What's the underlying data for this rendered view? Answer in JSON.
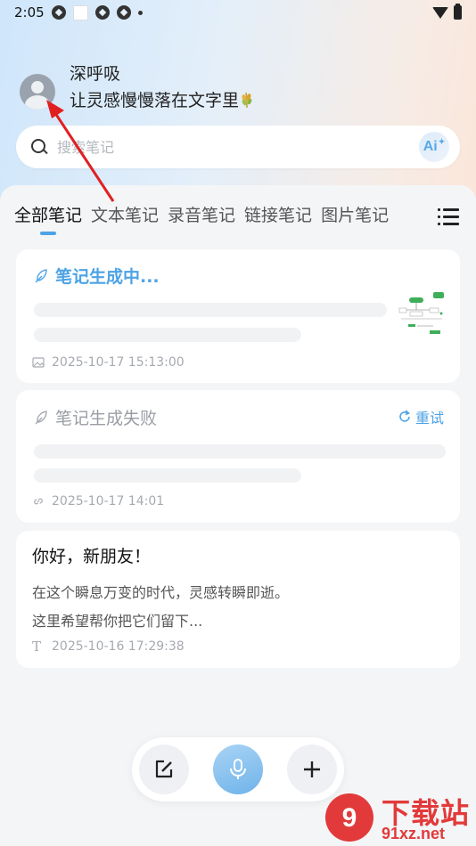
{
  "status_bar": {
    "time": "2:05"
  },
  "profile": {
    "username": "深呼吸",
    "tagline": "让灵感慢慢落在文字里"
  },
  "search": {
    "placeholder": "搜索笔记",
    "ai_label": "Ai"
  },
  "tabs": [
    {
      "label": "全部笔记",
      "active": true
    },
    {
      "label": "文本笔记",
      "active": false
    },
    {
      "label": "录音笔记",
      "active": false
    },
    {
      "label": "链接笔记",
      "active": false
    },
    {
      "label": "图片笔记",
      "active": false
    }
  ],
  "notes": [
    {
      "title": "笔记生成中...",
      "status": "generating",
      "type_icon": "image-icon",
      "timestamp": "2025-10-17 15:13:00"
    },
    {
      "title": "笔记生成失败",
      "status": "failed",
      "retry_label": "重试",
      "type_icon": "link-icon",
      "timestamp": "2025-10-17 14:01"
    },
    {
      "title": "你好，新朋友！",
      "status": "done",
      "lines": [
        "在这个瞬息万变的时代，灵感转瞬即逝。",
        "这里希望帮你把它们留下..."
      ],
      "type_icon": "text-icon",
      "type_glyph": "T",
      "timestamp": "2025-10-16 17:29:38"
    }
  ],
  "bottom_actions": [
    "edit-note",
    "voice-record",
    "add"
  ],
  "watermark": {
    "brand": "下载站",
    "domain": "91xz.net"
  },
  "colors": {
    "accent": "#4da3e6",
    "arrow": "#e02020"
  }
}
